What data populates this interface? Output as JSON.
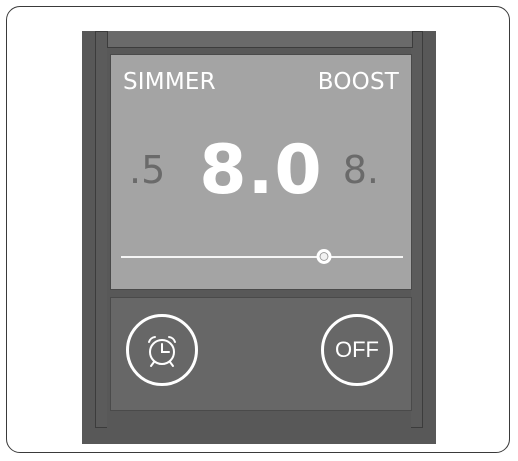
{
  "modes": {
    "left": "SIMMER",
    "right": "BOOST"
  },
  "values": {
    "prev": ".5",
    "current": "8.0",
    "next": "8."
  },
  "slider": {
    "level": 0.72
  },
  "buttons": {
    "timer_icon": "alarm-clock-icon",
    "off_label": "OFF"
  }
}
